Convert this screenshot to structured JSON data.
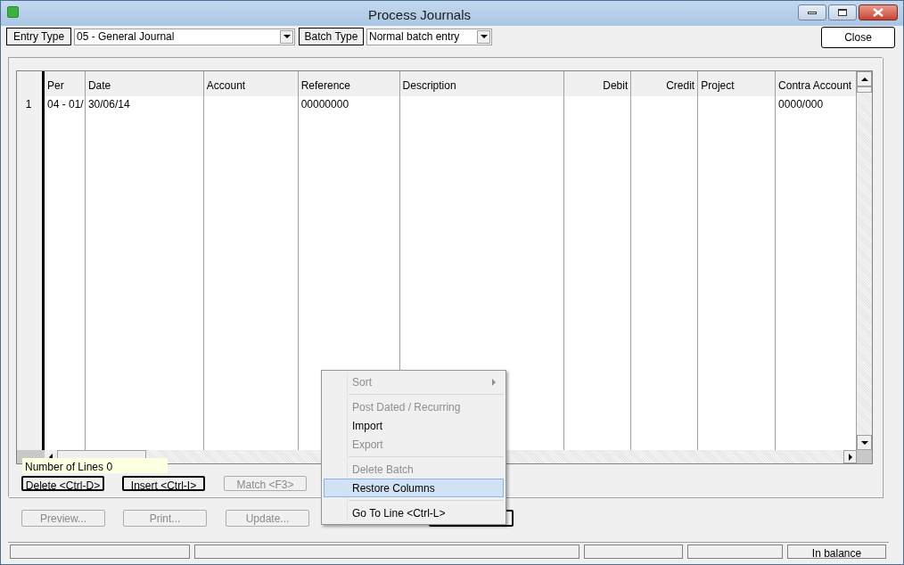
{
  "window": {
    "title": "Process Journals"
  },
  "toolbar": {
    "entry_type_button": "Entry Type",
    "entry_type_value": "05 - General Journal",
    "batch_type_button": "Batch Type",
    "batch_type_value": "Normal batch entry",
    "close_button": "Close"
  },
  "table": {
    "columns": [
      {
        "label": "Per",
        "kind": "text"
      },
      {
        "label": "Date",
        "kind": "text"
      },
      {
        "label": "Account",
        "kind": "text"
      },
      {
        "label": "Reference",
        "kind": "text"
      },
      {
        "label": "Description",
        "kind": "text"
      },
      {
        "label": "Debit",
        "kind": "amount"
      },
      {
        "label": "Credit",
        "kind": "amount"
      },
      {
        "label": "Project",
        "kind": "text"
      },
      {
        "label": "Contra Account",
        "kind": "text"
      }
    ],
    "rows": [
      {
        "number": "1",
        "cells": [
          "04 - 01/",
          "30/06/14",
          null,
          "00000000",
          null,
          null,
          null,
          null,
          "0000/000"
        ]
      }
    ]
  },
  "tooltip": "Number of Lines 0",
  "line_buttons": [
    {
      "label": "Delete <Ctrl-D>",
      "disabled": false
    },
    {
      "label": "Insert <Ctrl-I>",
      "disabled": false
    },
    {
      "label": "Match <F3>",
      "disabled": true
    }
  ],
  "action_buttons": [
    {
      "label": "Preview...",
      "disabled": true
    },
    {
      "label": "Print...",
      "disabled": true
    },
    {
      "label": "Update...",
      "disabled": true
    }
  ],
  "context_menu": {
    "items": [
      {
        "kind": "item",
        "label": "Sort",
        "disabled": true,
        "submenu": true,
        "selected": false
      },
      {
        "kind": "separator"
      },
      {
        "kind": "item",
        "label": "Post Dated / Recurring",
        "disabled": true,
        "submenu": false,
        "selected": false
      },
      {
        "kind": "item",
        "label": "Import",
        "disabled": false,
        "submenu": false,
        "selected": false
      },
      {
        "kind": "item",
        "label": "Export",
        "disabled": true,
        "submenu": false,
        "selected": false
      },
      {
        "kind": "separator"
      },
      {
        "kind": "item",
        "label": "Delete Batch",
        "disabled": true,
        "submenu": false,
        "selected": false
      },
      {
        "kind": "item",
        "label": "Restore Columns",
        "disabled": false,
        "submenu": false,
        "selected": true
      },
      {
        "kind": "separator"
      },
      {
        "kind": "item",
        "label": "Go To Line <Ctrl-L>",
        "disabled": false,
        "submenu": false,
        "selected": false
      }
    ]
  },
  "status_bar": {
    "balance": "In balance"
  }
}
